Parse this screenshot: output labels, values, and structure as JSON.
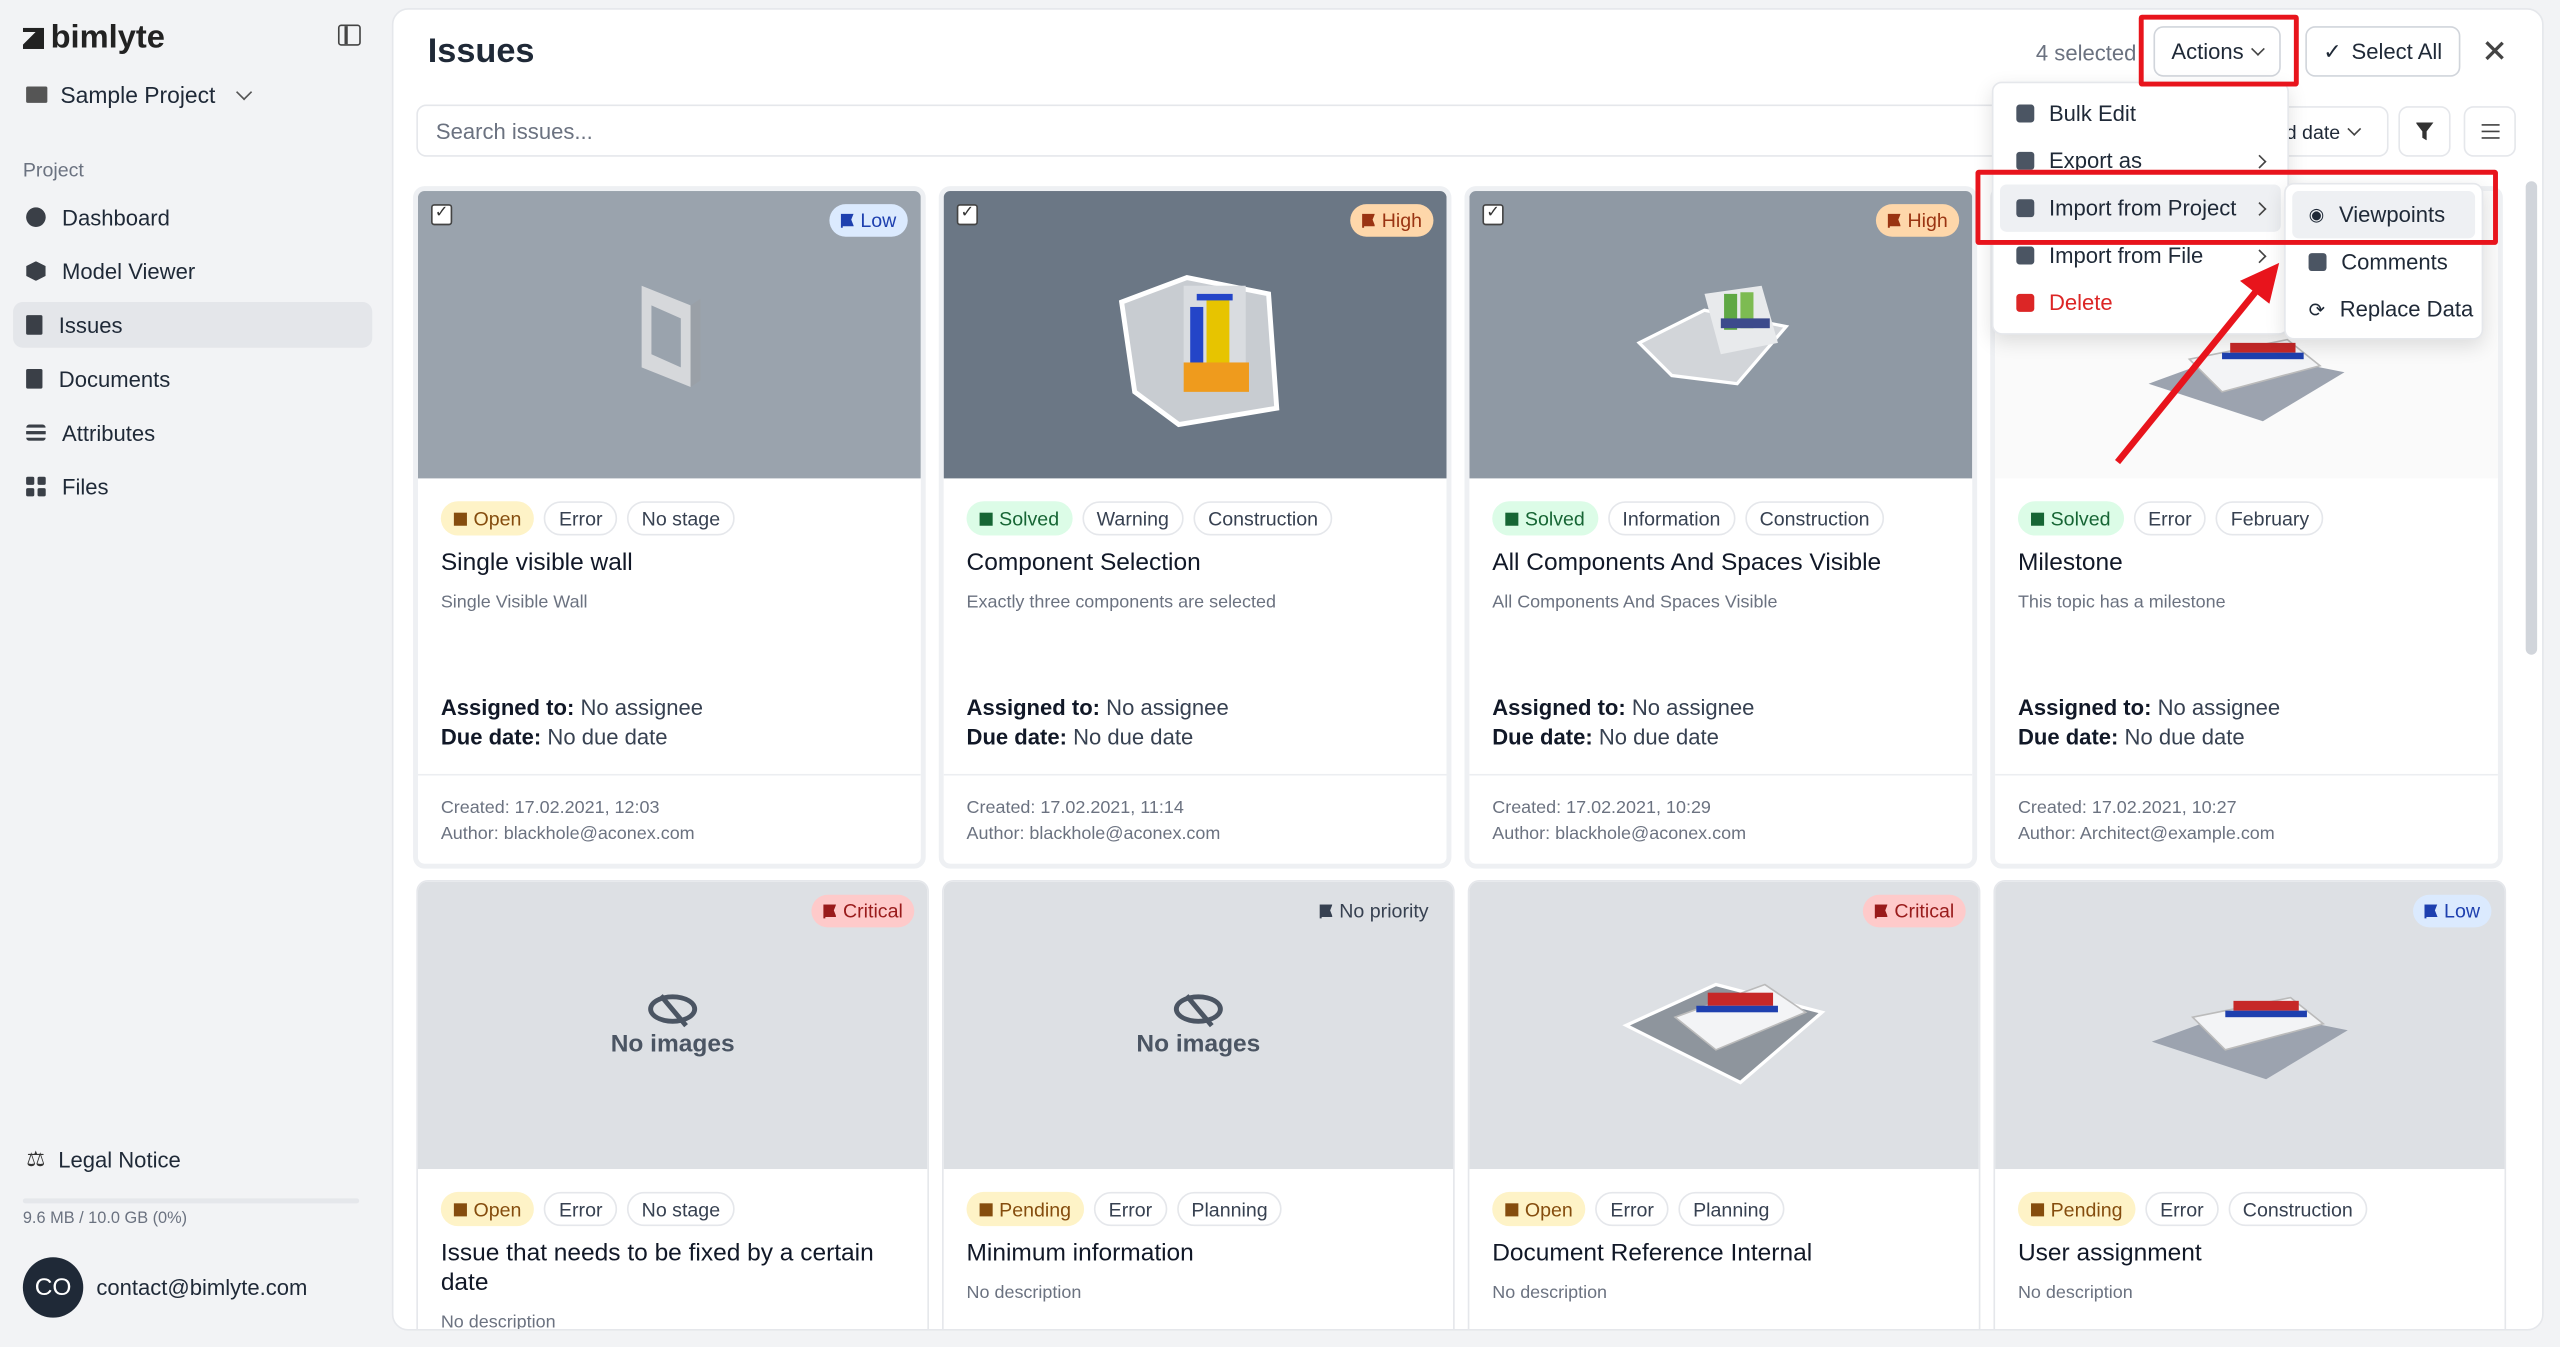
{
  "sidebar": {
    "logo": "bimlyte",
    "project_name": "Sample Project",
    "section_label": "Project",
    "items": [
      {
        "label": "Dashboard",
        "icon": "pie-chart-icon"
      },
      {
        "label": "Model Viewer",
        "icon": "cube-icon"
      },
      {
        "label": "Issues",
        "icon": "clipboard-icon",
        "active": true
      },
      {
        "label": "Documents",
        "icon": "document-icon"
      },
      {
        "label": "Attributes",
        "icon": "sliders-icon"
      },
      {
        "label": "Files",
        "icon": "grid-icon"
      }
    ],
    "legal": "Legal Notice",
    "storage": "9.6 MB / 10.0 GB (0%)",
    "storage_used_fraction": 0.0,
    "user_initials": "CO",
    "user_email": "contact@bimlyte.com"
  },
  "header": {
    "title": "Issues",
    "selected_count": "4 selected",
    "actions_label": "Actions",
    "select_all_label": "Select All"
  },
  "toolbar": {
    "search_placeholder": "Search issues...",
    "sort_label": "d date"
  },
  "actions_menu": {
    "items": [
      {
        "label": "Bulk Edit",
        "icon": "edit-icon"
      },
      {
        "label": "Export as",
        "icon": "export-icon",
        "submenu": true
      },
      {
        "label": "Import from Project",
        "icon": "import-icon",
        "submenu": true,
        "highlighted": true
      },
      {
        "label": "Import from File",
        "icon": "file-import-icon",
        "submenu": true
      },
      {
        "label": "Delete",
        "icon": "trash-icon",
        "danger": true
      }
    ]
  },
  "import_submenu": {
    "items": [
      {
        "label": "Viewpoints",
        "icon": "eye-icon",
        "highlighted": true
      },
      {
        "label": "Comments",
        "icon": "comment-icon"
      },
      {
        "label": "Replace Data",
        "icon": "refresh-icon"
      }
    ]
  },
  "cards": [
    {
      "priority": "Low",
      "status": "Open",
      "type": "Error",
      "stage": "No stage",
      "title": "Single visible wall",
      "description": "Single Visible Wall",
      "assigned_label": "Assigned to:",
      "assigned": "No assignee",
      "due_label": "Due date:",
      "due": "No due date",
      "created": "Created: 17.02.2021, 12:03",
      "author": "Author: blackhole@aconex.com",
      "selected": true
    },
    {
      "priority": "High",
      "status": "Solved",
      "type": "Warning",
      "stage": "Construction",
      "title": "Component Selection",
      "description": "Exactly three components are selected",
      "assigned_label": "Assigned to:",
      "assigned": "No assignee",
      "due_label": "Due date:",
      "due": "No due date",
      "created": "Created: 17.02.2021, 11:14",
      "author": "Author: blackhole@aconex.com",
      "selected": true
    },
    {
      "priority": "High",
      "status": "Solved",
      "type": "Information",
      "stage": "Construction",
      "title": "All Components And Spaces Visible",
      "description": "All Components And Spaces Visible",
      "assigned_label": "Assigned to:",
      "assigned": "No assignee",
      "due_label": "Due date:",
      "due": "No due date",
      "created": "Created: 17.02.2021, 10:29",
      "author": "Author: blackhole@aconex.com",
      "selected": true
    },
    {
      "priority": "",
      "status": "Solved",
      "type": "Error",
      "stage": "February",
      "title": "Milestone",
      "description": "This topic has a milestone",
      "assigned_label": "Assigned to:",
      "assigned": "No assignee",
      "due_label": "Due date:",
      "due": "No due date",
      "created": "Created: 17.02.2021, 10:27",
      "author": "Author: Architect@example.com",
      "selected": true
    },
    {
      "priority": "Critical",
      "status": "Open",
      "type": "Error",
      "stage": "No stage",
      "title": "Issue that needs to be fixed by a certain date",
      "description": "No description",
      "no_images": "No images"
    },
    {
      "priority": "No priority",
      "status": "Pending",
      "type": "Error",
      "stage": "Planning",
      "title": "Minimum information",
      "description": "No description",
      "no_images": "No images"
    },
    {
      "priority": "Critical",
      "status": "Open",
      "type": "Error",
      "stage": "Planning",
      "title": "Document Reference Internal",
      "description": "No description"
    },
    {
      "priority": "Low",
      "status": "Pending",
      "type": "Error",
      "stage": "Construction",
      "title": "User assignment",
      "description": "No description"
    }
  ],
  "colors": {
    "accent_red_annotation": "#e8141c",
    "delete": "#dc2626",
    "open_tag": "#fef3c7",
    "solved_tag": "#dcfce7"
  }
}
